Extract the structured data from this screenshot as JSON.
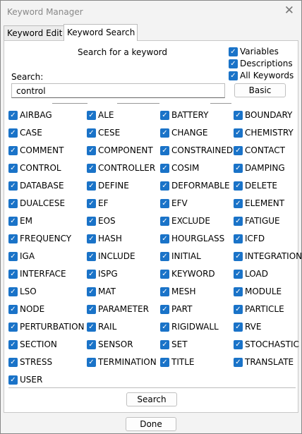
{
  "window": {
    "title": "Keyword Manager"
  },
  "tabs": [
    {
      "label": "Keyword Edit",
      "active": false
    },
    {
      "label": "Keyword Search",
      "active": true
    }
  ],
  "search_panel": {
    "heading": "Search for a keyword",
    "options": [
      {
        "label": "Variables",
        "checked": true
      },
      {
        "label": "Descriptions",
        "checked": true
      },
      {
        "label": "All Keywords",
        "checked": true
      }
    ],
    "search_label": "Search:",
    "search_value": "control",
    "basic_button": "Basic",
    "search_button": "Search"
  },
  "keywords": [
    "AIRBAG",
    "ALE",
    "BATTERY",
    "BOUNDARY",
    "CASE",
    "CESE",
    "CHANGE",
    "CHEMISTRY",
    "COMMENT",
    "COMPONENT",
    "CONSTRAINED",
    "CONTACT",
    "CONTROL",
    "CONTROLLER",
    "COSIM",
    "DAMPING",
    "DATABASE",
    "DEFINE",
    "DEFORMABLE",
    "DELETE",
    "DUALCESE",
    "EF",
    "EFV",
    "ELEMENT",
    "EM",
    "EOS",
    "EXCLUDE",
    "FATIGUE",
    "FREQUENCY",
    "HASH",
    "HOURGLASS",
    "ICFD",
    "IGA",
    "INCLUDE",
    "INITIAL",
    "INTEGRATION",
    "INTERFACE",
    "ISPG",
    "KEYWORD",
    "LOAD",
    "LSO",
    "MAT",
    "MESH",
    "MODULE",
    "NODE",
    "PARAMETER",
    "PART",
    "PARTICLE",
    "PERTURBATION",
    "RAIL",
    "RIGIDWALL",
    "RVE",
    "SECTION",
    "SENSOR",
    "SET",
    "STOCHASTIC",
    "STRESS",
    "TERMINATION",
    "TITLE",
    "TRANSLATE",
    "USER"
  ],
  "keywords_checked": true,
  "footer": {
    "done_button": "Done"
  },
  "colors": {
    "checkbox": "#1a73c8"
  }
}
